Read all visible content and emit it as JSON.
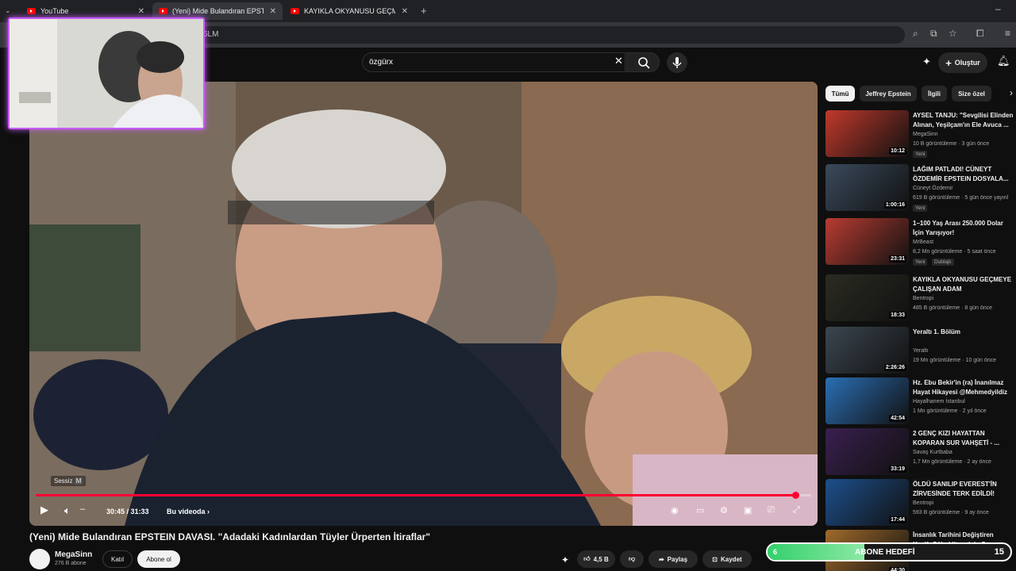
{
  "browser": {
    "tabs": [
      {
        "label": "YouTube"
      },
      {
        "label": "(Yeni) Mide Bulandıran EPSTEIN"
      },
      {
        "label": "KAYIKLA OKYANUSU GEÇMEYE"
      }
    ],
    "url_fragment": "6LM"
  },
  "masthead": {
    "search_value": "özgürx",
    "create_label": "Oluştur"
  },
  "player": {
    "time": "30:45 / 31:33",
    "chapter": "Bu videoda",
    "mute_tip": "Sessiz",
    "mute_key": "M",
    "progress_fraction": 0.98
  },
  "video": {
    "title": "(Yeni) Mide Bulandıran EPSTEIN DAVASI. \"Adadaki Kadınlardan Tüyler Ürperten İtiraflar\"",
    "channel": "MegaSinn",
    "subscribers": "276 B abone",
    "join": "Katıl",
    "subscribe": "Abone ol",
    "likes": "4,5 B",
    "share": "Paylaş",
    "save": "Kaydet"
  },
  "chips": [
    "Tümü",
    "Jeffrey Epstein",
    "İlgili",
    "Size özel"
  ],
  "recommendations": [
    {
      "title": "AYSEL TANJU: \"Sevgilisi Elinden",
      "title2": "Alınan, Yeşilçam'ın Ele Avuca ...",
      "channel": "MegaSinn",
      "meta": "10 B görüntüleme · 3 gün önce",
      "badge": "Yeni",
      "duration": "10:12",
      "color": "#c0392b"
    },
    {
      "title": "LAĞIM PATLADI! CÜNEYT",
      "title2": "ÖZDEMİR EPSTEIN DOSYALA...",
      "channel": "Cüneyt Özdemir",
      "meta": "619 B görüntüleme · 5 gün önce yayınl",
      "badge": "Yeni",
      "duration": "1:00:16",
      "color": "#3a4a5c"
    },
    {
      "title": "1–100 Yaş Arası 250.000 Dolar",
      "title2": "İçin Yarışıyor!",
      "channel": "MrBeast",
      "meta": "8,2 Mn görüntüleme · 5 saat önce",
      "badge": "Yeni",
      "badge2": "Dublajlı",
      "duration": "23:31",
      "color": "#b83c32"
    },
    {
      "title": "KAYIKLA OKYANUSU GEÇMEYE",
      "title2": "ÇALIŞAN ADAM",
      "channel": "Bentropi",
      "meta": "485 B görüntüleme · 8 gün önce",
      "duration": "18:33",
      "color": "#2b2b22"
    },
    {
      "title": "Yeraltı 1. Bölüm",
      "title2": "",
      "channel": "Yeraltı",
      "meta": "19 Mn görüntüleme · 10 gün önce",
      "duration": "2:26:26",
      "color": "#3b4650"
    },
    {
      "title": "Hz. Ebu Bekir'in (ra) İnanılmaz",
      "title2": "Hayat Hikayesi @Mehmedyildiz",
      "channel": "Hayalhanem İstanbul",
      "meta": "1 Mn görüntüleme · 2 yıl önce",
      "duration": "42:54",
      "color": "#2a6fb5"
    },
    {
      "title": "2 GENÇ KIZI HAYATTAN",
      "title2": "KOPARAN SUR VAHŞETİ - ...",
      "channel": "Savaş Kurtbaba",
      "meta": "1,7 Mn görüntüleme · 2 ay önce",
      "duration": "33:19",
      "color": "#3a1f4f"
    },
    {
      "title": "ÖLDÜ SANILIP EVEREST'İN",
      "title2": "ZİRVESİNDE TERK EDİLDİ!",
      "channel": "Bentropi",
      "meta": "593 B görüntüleme · 9 ay önce",
      "duration": "17:44",
      "color": "#1d4f8c"
    },
    {
      "title": "İnsanlık Tarihini Değiştiren",
      "title2": "Keşif: Göbeklitepe'nin Sırrı",
      "channel": "",
      "meta": "",
      "duration": "44:30",
      "color": "#a06a2c"
    }
  ],
  "goal": {
    "label": "ABONE HEDEFİ",
    "start": "6",
    "end": "15",
    "progress_fraction": 0.4
  }
}
